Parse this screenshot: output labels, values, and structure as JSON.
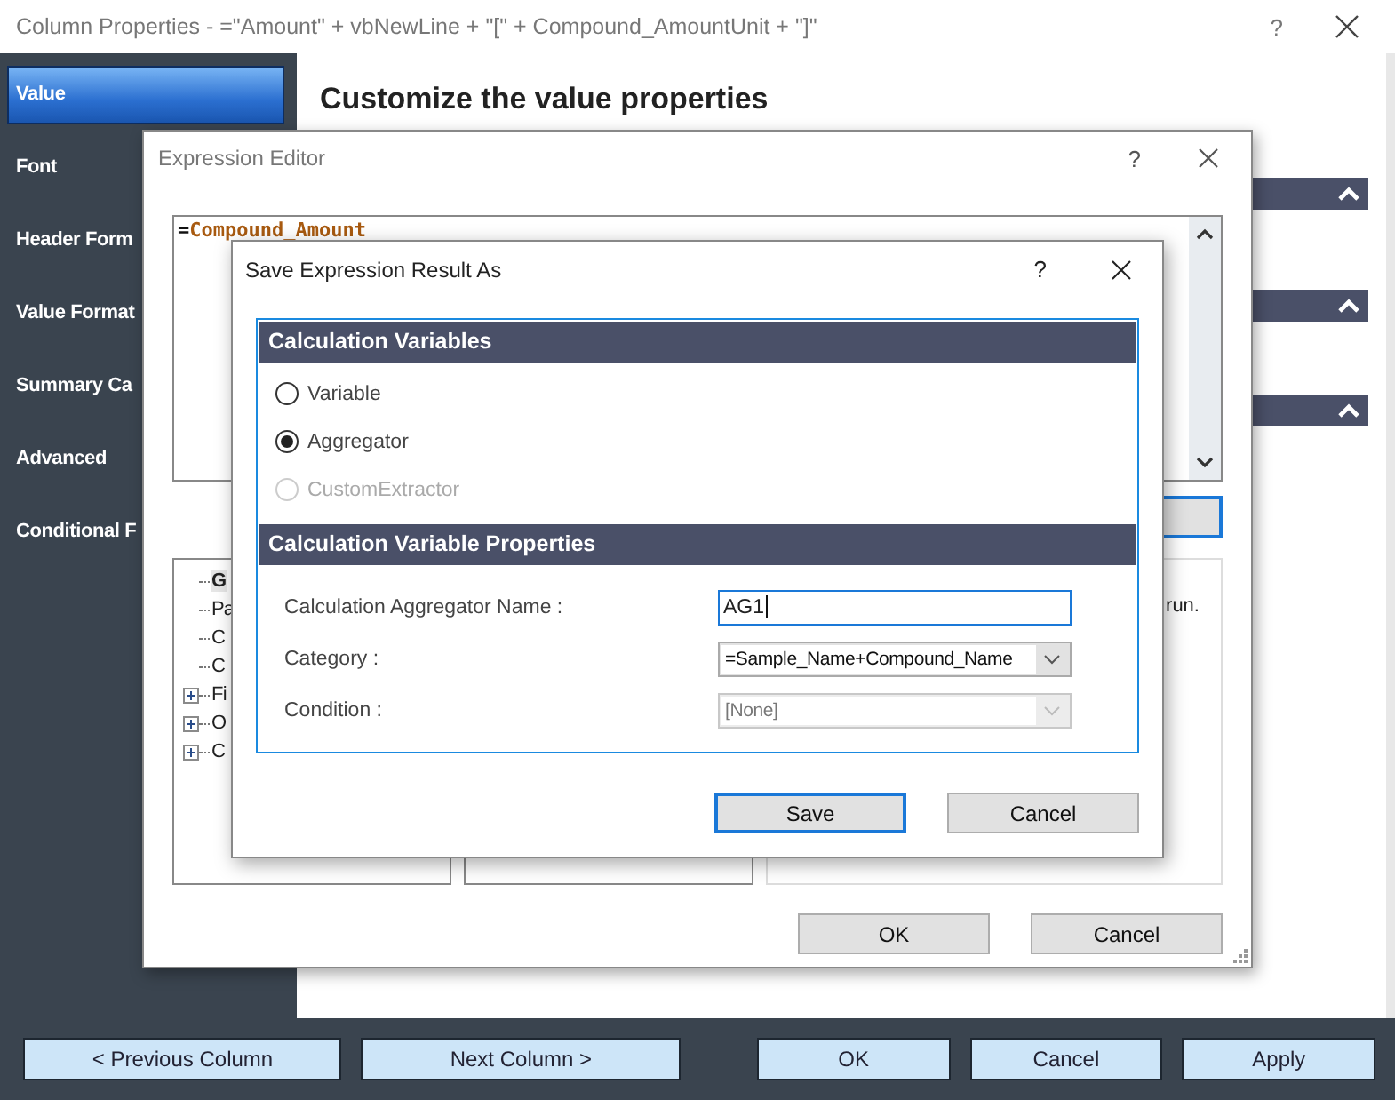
{
  "window": {
    "title": "Column Properties - =\"Amount\" + vbNewLine + \"[\" + Compound_AmountUnit + \"]\"",
    "help": "?"
  },
  "sidebar": {
    "items": [
      {
        "label": "Value",
        "selected": true
      },
      {
        "label": "Font",
        "selected": false
      },
      {
        "label": "Header Form",
        "selected": false
      },
      {
        "label": "Value Format",
        "selected": false
      },
      {
        "label": "Summary Ca",
        "selected": false
      },
      {
        "label": "Advanced",
        "selected": false
      },
      {
        "label": "Conditional F",
        "selected": false
      }
    ]
  },
  "content": {
    "heading": "Customize the value properties",
    "sections": [
      {
        "expanded": true
      },
      {
        "expanded": true
      },
      {
        "expanded": true
      }
    ]
  },
  "expression_editor": {
    "title": "Expression Editor",
    "help": "?",
    "expression": [
      {
        "kind": "operator",
        "text": "="
      },
      {
        "kind": "field",
        "text": "Compound_Amount"
      }
    ],
    "tree": [
      {
        "label": "G",
        "kind": "leaf",
        "selected": true
      },
      {
        "label": "Pa",
        "kind": "leaf",
        "selected": false
      },
      {
        "label": "C",
        "kind": "leaf",
        "selected": false
      },
      {
        "label": "C",
        "kind": "leaf",
        "selected": false
      },
      {
        "label": "Fi",
        "kind": "group",
        "selected": false
      },
      {
        "label": "O",
        "kind": "group",
        "selected": false
      },
      {
        "label": "C",
        "kind": "group",
        "selected": false
      }
    ],
    "note": "run.",
    "buttons": [
      "OK",
      "Cancel"
    ]
  },
  "save_dialog": {
    "title": "Save Expression Result As",
    "help": "?",
    "variables_heading": "Calculation Variables",
    "options": [
      {
        "label": "Variable",
        "selected": false,
        "disabled": false
      },
      {
        "label": "Aggregator",
        "selected": true,
        "disabled": false
      },
      {
        "label": "CustomExtractor",
        "selected": false,
        "disabled": true
      }
    ],
    "properties_heading": "Calculation Variable Properties",
    "fields": [
      {
        "kind": "text",
        "label": "Calculation Aggregator Name :",
        "value": "AG1",
        "disabled": false
      },
      {
        "kind": "select",
        "label": "Category :",
        "value": "=Sample_Name+Compound_Name",
        "disabled": false
      },
      {
        "kind": "select",
        "label": "Condition :",
        "value": "[None]",
        "disabled": true
      }
    ],
    "buttons": [
      {
        "label": "Save",
        "default": true
      },
      {
        "label": "Cancel",
        "default": false
      }
    ]
  },
  "footer": {
    "buttons": [
      "< Previous Column",
      "Next Column >",
      "OK",
      "Cancel",
      "Apply"
    ]
  }
}
